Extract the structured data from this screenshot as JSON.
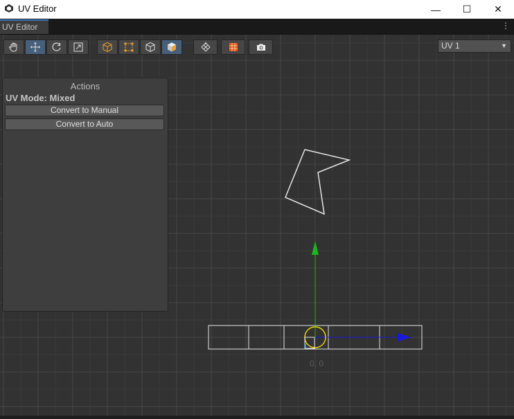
{
  "window": {
    "title": "UV Editor",
    "minimize": "—",
    "maximize": "☐",
    "close": "✕"
  },
  "tab": {
    "label": "UV Editor",
    "menu": "⋮"
  },
  "toolbar": {
    "tools": [
      {
        "name": "hand-tool-button",
        "icon": "hand-icon",
        "active": false
      },
      {
        "name": "move-tool-button",
        "icon": "move-icon",
        "active": true
      },
      {
        "name": "rotate-tool-button",
        "icon": "rotate-icon",
        "active": false
      },
      {
        "name": "scale-tool-button",
        "icon": "scale-icon",
        "active": false
      }
    ],
    "select_modes": [
      {
        "name": "vertex-select-button",
        "icon": "vertex-cube-icon",
        "active": false
      },
      {
        "name": "edge-select-button",
        "icon": "edge-square-icon",
        "active": false
      },
      {
        "name": "face-select-button",
        "icon": "face-cube-icon",
        "active": false
      },
      {
        "name": "object-select-button",
        "icon": "object-cube-icon",
        "active": true
      }
    ],
    "extras": [
      {
        "name": "unfold-button",
        "icon": "unfold-icon"
      },
      {
        "name": "texture-button",
        "icon": "texture-icon"
      },
      {
        "name": "screenshot-button",
        "icon": "camera-icon"
      }
    ]
  },
  "uv_channel": {
    "selected": "UV 1",
    "arrow": "▼"
  },
  "actions_panel": {
    "title": "Actions",
    "mode_label": "UV Mode: Mixed",
    "buttons": [
      "Convert to Manual",
      "Convert to Auto"
    ]
  },
  "viewport": {
    "origin_label": "0, 0",
    "colors": {
      "grid_major": "#474747",
      "grid_minor": "#3a3a3a",
      "axis_y": "#1fb51f",
      "axis_x": "#1a1adb",
      "pivot": "#e8d400",
      "uv_outline": "#e6e6e6"
    }
  }
}
